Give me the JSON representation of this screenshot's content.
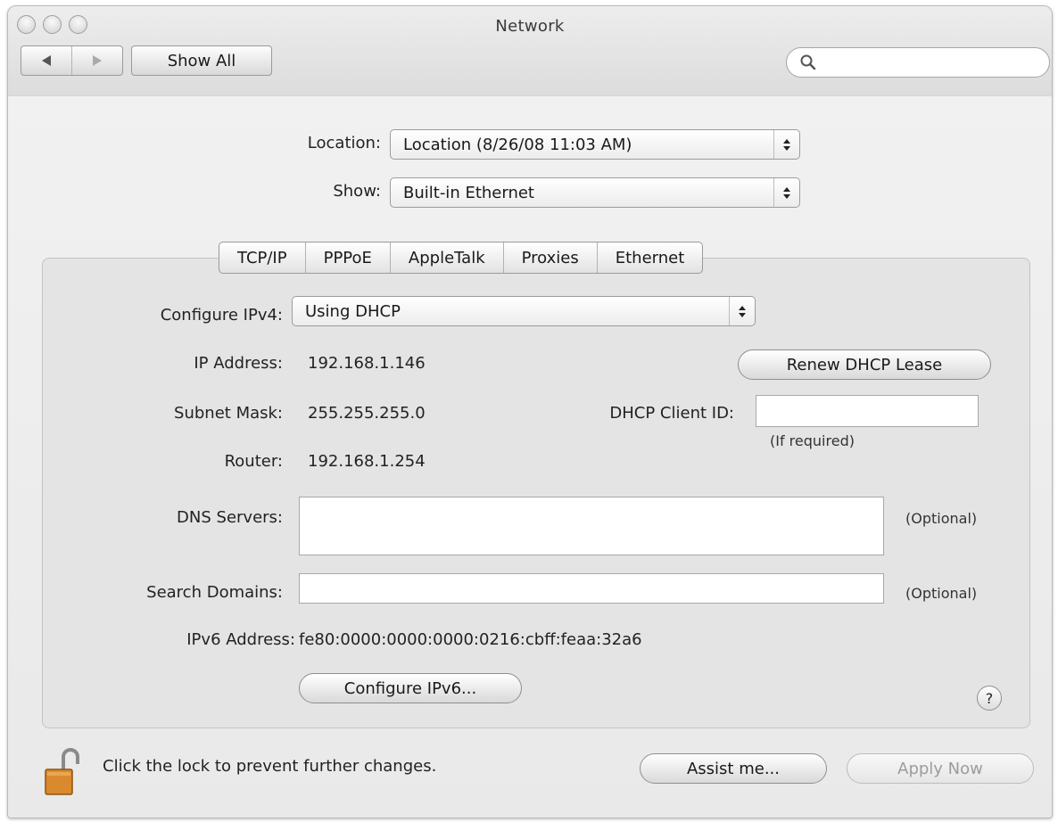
{
  "window": {
    "title": "Network"
  },
  "toolbar": {
    "show_all_label": "Show All",
    "search_placeholder": ""
  },
  "location": {
    "label": "Location:",
    "value": "Location (8/26/08 11:03 AM)"
  },
  "show": {
    "label": "Show:",
    "value": "Built-in Ethernet"
  },
  "tabs": [
    {
      "label": "TCP/IP"
    },
    {
      "label": "PPPoE"
    },
    {
      "label": "AppleTalk"
    },
    {
      "label": "Proxies"
    },
    {
      "label": "Ethernet"
    }
  ],
  "tcpip": {
    "configure_ipv4_label": "Configure IPv4:",
    "configure_ipv4_value": "Using DHCP",
    "ip_address_label": "IP Address:",
    "ip_address_value": "192.168.1.146",
    "renew_dhcp_label": "Renew DHCP Lease",
    "subnet_mask_label": "Subnet Mask:",
    "subnet_mask_value": "255.255.255.0",
    "dhcp_client_id_label": "DHCP Client ID:",
    "dhcp_client_id_value": "",
    "if_required_note": "(If required)",
    "router_label": "Router:",
    "router_value": "192.168.1.254",
    "dns_servers_label": "DNS Servers:",
    "dns_servers_value": "",
    "dns_optional_note": "(Optional)",
    "search_domains_label": "Search Domains:",
    "search_domains_value": "",
    "search_domains_optional_note": "(Optional)",
    "ipv6_address_label": "IPv6 Address:",
    "ipv6_address_value": "fe80:0000:0000:0000:0216:cbff:feaa:32a6",
    "configure_ipv6_label": "Configure IPv6...",
    "help_label": "?"
  },
  "footer": {
    "lock_text": "Click the lock to prevent further changes.",
    "assist_label": "Assist me...",
    "apply_label": "Apply Now"
  },
  "icons": {
    "search": "magnifier-icon",
    "lock": "open-padlock-icon",
    "back": "back-arrow-icon",
    "forward": "forward-arrow-icon"
  },
  "colors": {
    "window_bg": "#e9e9e9",
    "panel_bg": "#e4e4e4",
    "lock_body": "#d98a2c"
  }
}
